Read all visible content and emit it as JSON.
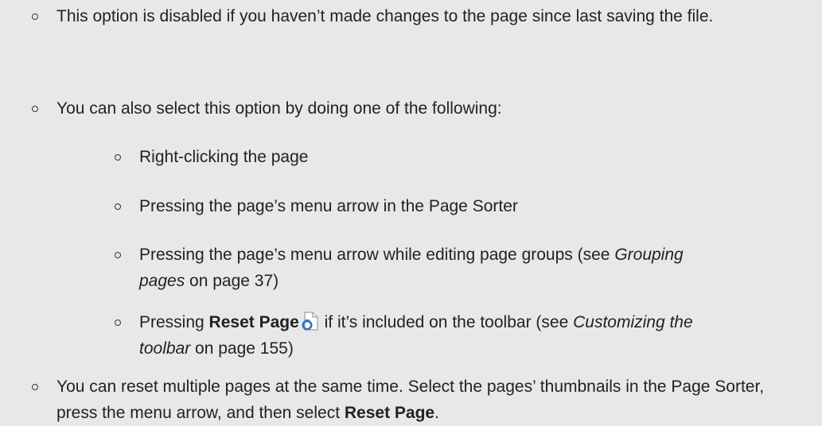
{
  "items": [
    {
      "level": 1,
      "text": "This option is disabled if you haven’t made changes to the page since last saving the file."
    },
    {
      "level": 1,
      "text": "You can also select this option by doing one of the following:"
    },
    {
      "level": 2,
      "text": "Right-clicking the page"
    },
    {
      "level": 2,
      "text": "Pressing the page’s menu arrow in the Page Sorter"
    },
    {
      "level": 2,
      "parts": {
        "before": "Pressing the page’s menu arrow while editing page groups (see ",
        "link": "Grouping pages",
        "after": " on page 37)"
      }
    },
    {
      "level": 2,
      "parts": {
        "before": "Pressing ",
        "bold": "Reset Page",
        "middle": " if it’s included on the toolbar (see ",
        "link": "Customizing the toolbar",
        "after": " on page 155)"
      },
      "icon": "reset-page-icon"
    },
    {
      "level": 1,
      "parts": {
        "before": "You can reset multiple pages at the same time. Select the pages’ thumbnails in the Page Sorter, press the menu arrow, and then select ",
        "bold": "Reset Page",
        "after": "."
      }
    }
  ],
  "colors": {
    "background": "#e8e8e8",
    "text": "#222222",
    "icon_blue": "#2d73c4"
  }
}
